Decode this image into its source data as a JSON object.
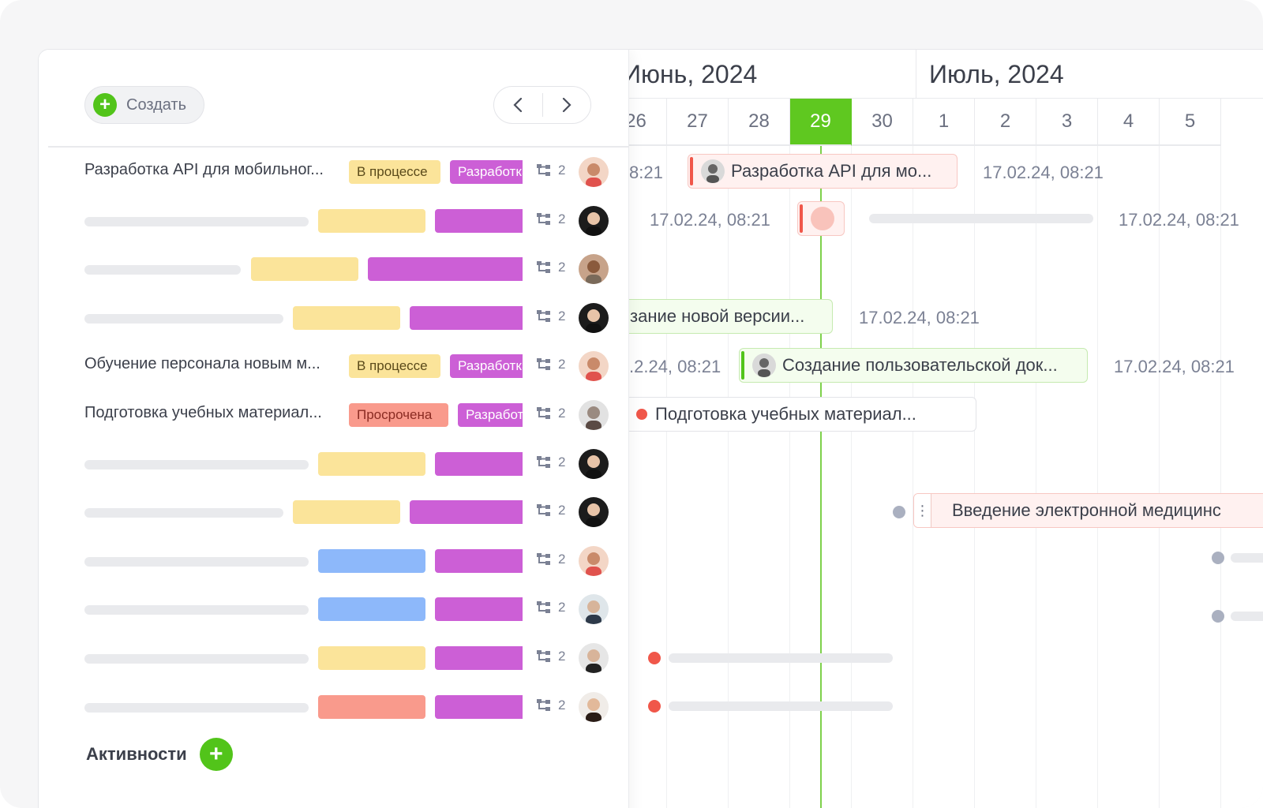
{
  "toolbar": {
    "create_label": "Создать",
    "prev_label": "‹",
    "next_label": "›"
  },
  "rows": [
    {
      "title": "Разработка API для мобильног...",
      "status": "В процессе",
      "type": "Разработка",
      "subtasks": "2"
    },
    {
      "title": "",
      "status": "",
      "type": "",
      "subtasks": "2"
    },
    {
      "title": "",
      "status": "",
      "type": "",
      "subtasks": "2"
    },
    {
      "title": "",
      "status": "",
      "type": "",
      "subtasks": "2"
    },
    {
      "title": "Обучение персонала новым м...",
      "status": "В процессе",
      "type": "Разработка",
      "subtasks": "2"
    },
    {
      "title": "Подготовка учебных материал...",
      "status": "Просрочена",
      "type": "Разработка",
      "subtasks": "2"
    },
    {
      "title": "",
      "status": "",
      "type": "",
      "subtasks": "2"
    },
    {
      "title": "",
      "status": "",
      "type": "",
      "subtasks": "2"
    },
    {
      "title": "",
      "status": "",
      "type": "",
      "subtasks": "2"
    },
    {
      "title": "",
      "status": "",
      "type": "",
      "subtasks": "2"
    },
    {
      "title": "",
      "status": "",
      "type": "",
      "subtasks": "2"
    },
    {
      "title": "",
      "status": "",
      "type": "",
      "subtasks": "2"
    }
  ],
  "activities": {
    "label": "Активности"
  },
  "timeline": {
    "months": [
      "Июнь, 2024",
      "Июль, 2024"
    ],
    "days": [
      "26",
      "27",
      "28",
      "29",
      "30",
      "1",
      "2",
      "3",
      "4",
      "5"
    ],
    "today": "29",
    "bars": {
      "api": "Разработка API для мо...",
      "version": "зание новой версии...",
      "docs": "Создание пользовательской док...",
      "materials": "Подготовка учебных материал...",
      "medical": "Введение электронной медицинс"
    },
    "dates": {
      "d1": "8:21",
      "d2": "17.02.24, 08:21",
      "d3": "17.02.24, 08:21",
      "d4": "17.02.24, 08:21",
      "d5": "17.02.24, 08:21",
      "d6": ".2.24, 08:21",
      "d7": "17.02.24, 08:21"
    }
  },
  "colors": {
    "accent_green": "#52c41a",
    "today": "#5fc820",
    "status_in_progress": "#fbe49a",
    "status_overdue": "#f99a8c",
    "type_dev": "#cc5fd6",
    "status_blue": "#8db8fa",
    "overdue_dot": "#f0574a",
    "neutral_dot": "#aab0c0"
  }
}
